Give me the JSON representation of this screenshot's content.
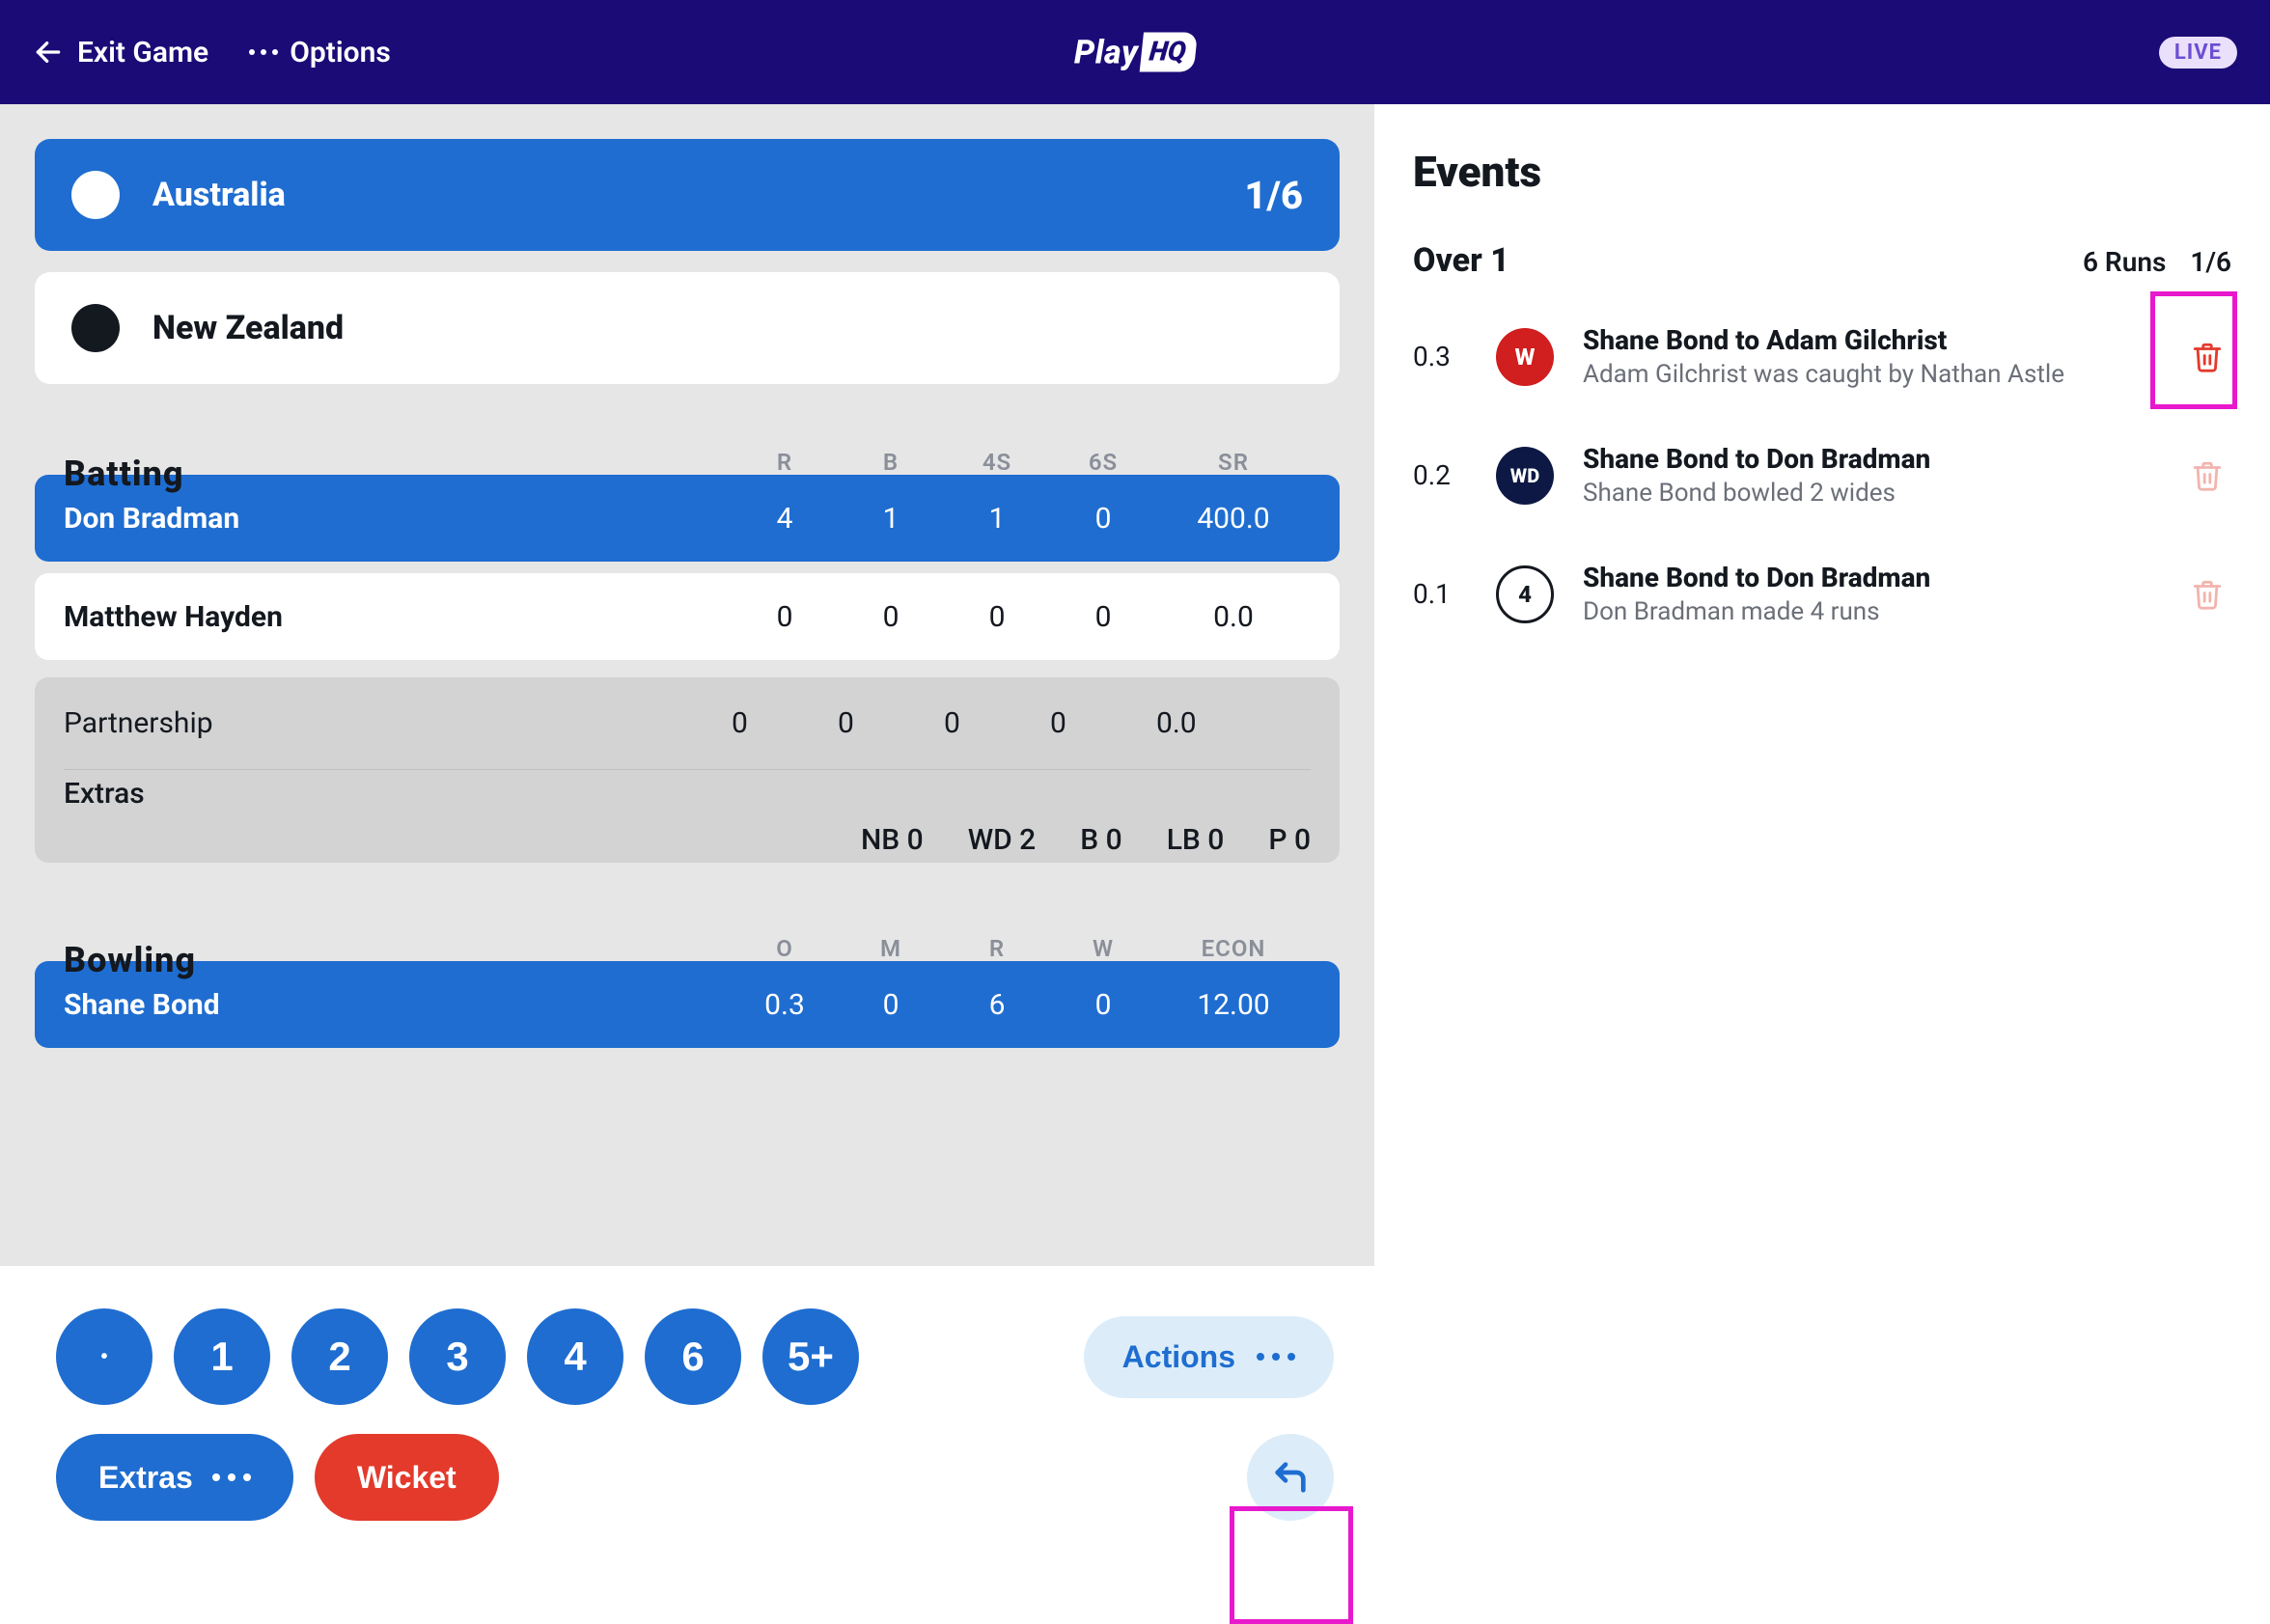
{
  "topbar": {
    "exit": "Exit Game",
    "options": "Options",
    "logo_play": "Play",
    "logo_hq": "HQ",
    "live": "LIVE"
  },
  "teams": {
    "active": {
      "name": "Australia",
      "score": "1/6"
    },
    "inactive": {
      "name": "New Zealand"
    }
  },
  "batting": {
    "heading": "Batting",
    "columns": [
      "R",
      "B",
      "4S",
      "6S",
      "SR"
    ],
    "rows": [
      {
        "name": "Don Bradman",
        "r": "4",
        "b": "1",
        "fours": "1",
        "sixes": "0",
        "sr": "400.0",
        "active": true
      },
      {
        "name": "Matthew Hayden",
        "r": "0",
        "b": "0",
        "fours": "0",
        "sixes": "0",
        "sr": "0.0",
        "active": false
      }
    ],
    "partnership": {
      "label": "Partnership",
      "r": "0",
      "b": "0",
      "fours": "0",
      "sixes": "0",
      "sr": "0.0"
    },
    "extras": {
      "label": "Extras",
      "nb": "NB 0",
      "wd": "WD 2",
      "b": "B 0",
      "lb": "LB 0",
      "p": "P 0"
    }
  },
  "bowling": {
    "heading": "Bowling",
    "columns": [
      "O",
      "M",
      "R",
      "W",
      "ECON"
    ],
    "rows": [
      {
        "name": "Shane Bond",
        "o": "0.3",
        "m": "0",
        "r": "6",
        "w": "0",
        "econ": "12.00",
        "active": true
      }
    ]
  },
  "actionbar": {
    "runs": [
      "•",
      "1",
      "2",
      "3",
      "4",
      "6",
      "5+"
    ],
    "actions_label": "Actions",
    "extras_label": "Extras",
    "wicket_label": "Wicket"
  },
  "events": {
    "heading": "Events",
    "over_label": "Over 1",
    "over_summary_runs": "6 Runs",
    "over_summary_score": "1/6",
    "list": [
      {
        "over": "0.3",
        "badge": "W",
        "badge_style": "W",
        "title": "Shane Bond to Adam Gilchrist",
        "desc": "Adam Gilchrist was caught by Nathan Astle",
        "trash_active": true,
        "highlighted": true
      },
      {
        "over": "0.2",
        "badge": "WD",
        "badge_style": "WD",
        "title": "Shane Bond to Don Bradman",
        "desc": "Shane Bond bowled 2 wides",
        "trash_active": false,
        "highlighted": false
      },
      {
        "over": "0.1",
        "badge": "4",
        "badge_style": "four",
        "title": "Shane Bond to Don Bradman",
        "desc": "Don Bradman made 4 runs",
        "trash_active": false,
        "highlighted": false
      }
    ]
  }
}
